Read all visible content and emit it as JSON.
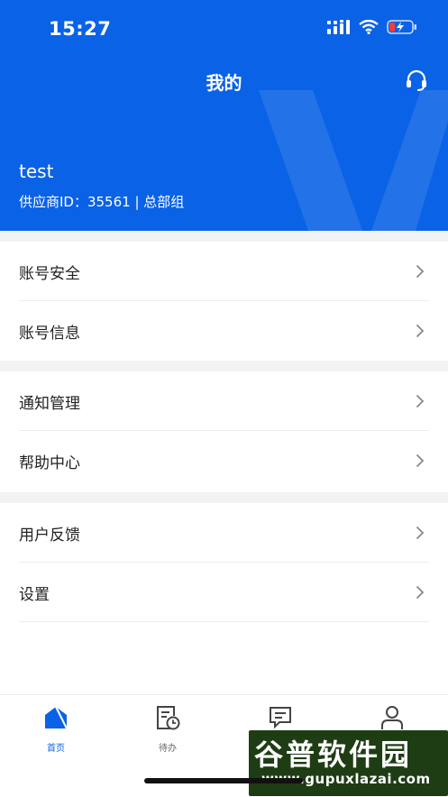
{
  "status_bar": {
    "time": "15:27"
  },
  "header": {
    "title": "我的",
    "user_name": "test",
    "supplier_line": "供应商ID：35561 | 总部组"
  },
  "menu_groups": [
    {
      "items": [
        {
          "label": "账号安全"
        },
        {
          "label": "账号信息"
        }
      ]
    },
    {
      "items": [
        {
          "label": "通知管理"
        },
        {
          "label": "帮助中心"
        }
      ]
    },
    {
      "items": [
        {
          "label": "用户反馈"
        },
        {
          "label": "设置"
        }
      ]
    }
  ],
  "tabbar": {
    "tabs": [
      {
        "label": "首页",
        "icon": "home-icon",
        "active": true
      },
      {
        "label": "待办",
        "icon": "todo-clock-icon",
        "active": false
      },
      {
        "label": "",
        "icon": "message-icon",
        "active": false
      },
      {
        "label": "",
        "icon": "user-icon",
        "active": false
      }
    ]
  },
  "watermark_logo": {
    "line1": "谷普软件园",
    "line2": "www.gupuxlazai.com"
  },
  "colors": {
    "brand": "#0a62e6",
    "background_gap": "#f2f3f5"
  }
}
